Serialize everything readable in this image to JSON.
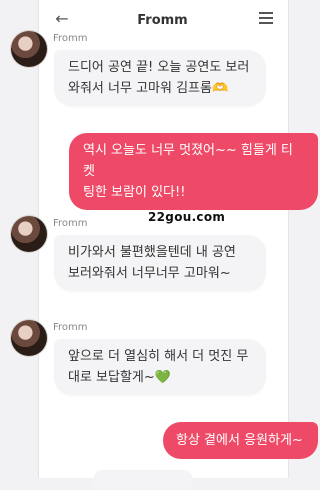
{
  "header": {
    "back_icon": "back-arrow-icon",
    "title": "Fromm",
    "menu_icon": "hamburger-menu-icon"
  },
  "messages": [
    {
      "direction": "in",
      "sender": "Fromm",
      "text": "드디어 공연 끝! 오늘 공연도 보러\n와줘서 너무 고마워 김프롬🫶"
    },
    {
      "direction": "out",
      "text": "역시 오늘도 너무 멋졌어~~ 힘들게 티켓\n팅한 보람이 있다!!"
    },
    {
      "direction": "in",
      "sender": "Fromm",
      "text": "비가와서 불편했을텐데 내 공연\n보러와줘서 너무너무 고마워~"
    },
    {
      "direction": "in",
      "sender": "Fromm",
      "text": "앞으로 더 열심히 해서 더 멋진 무\n대로 보답할게~💚"
    },
    {
      "direction": "out",
      "text": "항상 곁에서 응원하게~"
    }
  ],
  "watermark": "22gou.com",
  "colors": {
    "outgoing": "#ee4a67",
    "incoming": "#f4f4f6"
  }
}
